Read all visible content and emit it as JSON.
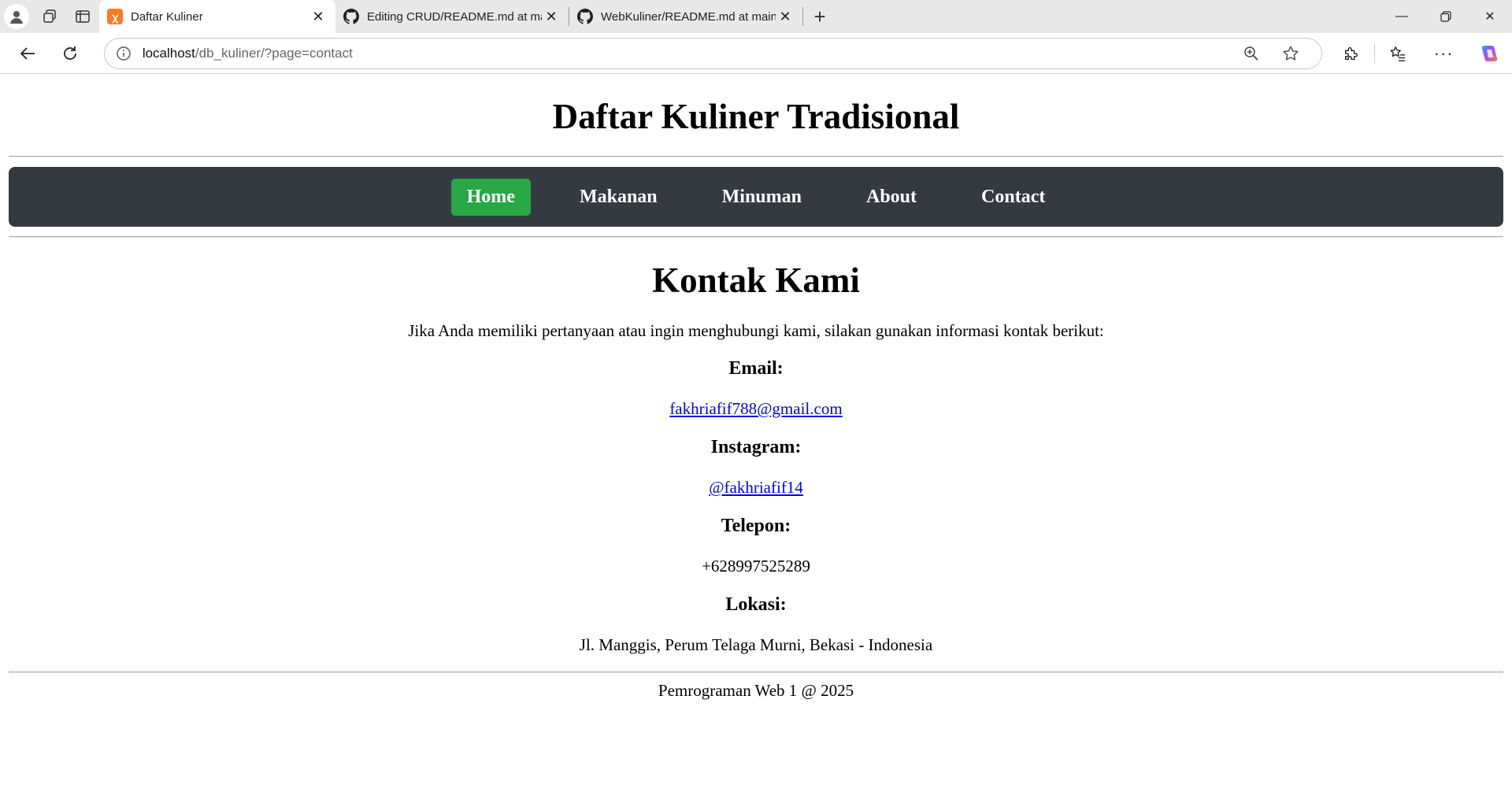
{
  "browser": {
    "tabs": [
      {
        "title": "Daftar Kuliner",
        "favicon": "xampp-icon",
        "active": true
      },
      {
        "title": "Editing CRUD/README.md at main",
        "favicon": "github-icon",
        "active": false
      },
      {
        "title": "WebKuliner/README.md at main",
        "favicon": "github-icon",
        "active": false
      }
    ],
    "url_host": "localhost",
    "url_path": "/db_kuliner/?page=contact"
  },
  "site": {
    "title": "Daftar Kuliner Tradisional",
    "nav": [
      {
        "label": "Home",
        "active": true
      },
      {
        "label": "Makanan",
        "active": false
      },
      {
        "label": "Minuman",
        "active": false
      },
      {
        "label": "About",
        "active": false
      },
      {
        "label": "Contact",
        "active": false
      }
    ]
  },
  "contact": {
    "heading": "Kontak Kami",
    "intro": "Jika Anda memiliki pertanyaan atau ingin menghubungi kami, silakan gunakan informasi kontak berikut:",
    "email_label": "Email:",
    "email_value": "fakhriafif788@gmail.com",
    "instagram_label": "Instagram:",
    "instagram_value": "@fakhriafif14",
    "phone_label": "Telepon:",
    "phone_value": "+628997525289",
    "location_label": "Lokasi:",
    "location_value": "Jl. Manggis, Perum Telaga Murni, Bekasi - Indonesia"
  },
  "footer": {
    "text": "Pemrograman Web 1 @ 2025"
  },
  "colors": {
    "navbar": "#343a40",
    "active_nav": "#28a745",
    "link": "#0000ee"
  }
}
